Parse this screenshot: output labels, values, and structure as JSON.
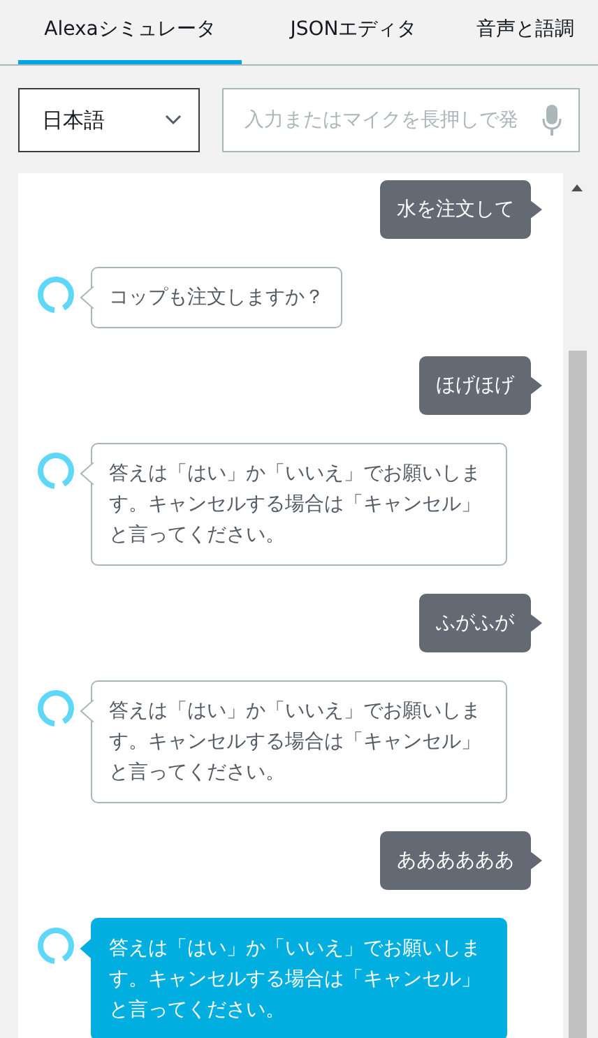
{
  "tabs": [
    {
      "label": "Alexaシミュレータ",
      "selected": true
    },
    {
      "label": "JSONエディタ",
      "selected": false
    },
    {
      "label": "音声と語調",
      "selected": false
    }
  ],
  "language_select": {
    "value": "日本語"
  },
  "utterance_input": {
    "placeholder": "入力またはマイクを長押しで発"
  },
  "messages": [
    {
      "kind": "user",
      "text": "水を注文して",
      "selected": false
    },
    {
      "kind": "alexa",
      "text": "コップも注文しますか？",
      "selected": false
    },
    {
      "kind": "user",
      "text": "ほげほげ",
      "selected": false
    },
    {
      "kind": "alexa",
      "text": "答えは「はい」か「いいえ」でお願いします。キャンセルする場合は「キャンセル」と言ってください。",
      "selected": false
    },
    {
      "kind": "user",
      "text": "ふがふが",
      "selected": false
    },
    {
      "kind": "alexa",
      "text": "答えは「はい」か「いいえ」でお願いします。キャンセルする場合は「キャンセル」と言ってください。",
      "selected": false
    },
    {
      "kind": "user",
      "text": "ああああああ",
      "selected": false
    },
    {
      "kind": "alexa",
      "text": "答えは「はい」か「いいえ」でお願いします。キャンセルする場合は「キャンセル」と言ってください。",
      "selected": true
    }
  ]
}
